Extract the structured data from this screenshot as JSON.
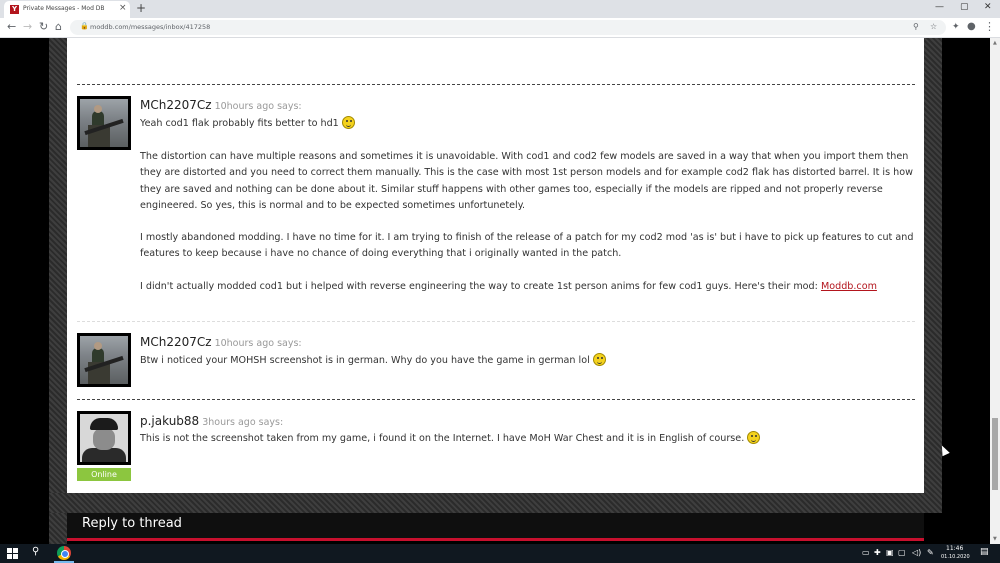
{
  "browser": {
    "tab_title": "Private Messages - Mod DB",
    "tab_favicon": "Y",
    "url": "moddb.com/messages/inbox/417258",
    "controls": {
      "minimize": "—",
      "maximize": "▢",
      "close": "✕",
      "new_tab": "+",
      "tab_close": "×"
    },
    "nav": {
      "back": "←",
      "forward": "→",
      "reload": "↻",
      "home": "⌂"
    },
    "omni_icons": {
      "lock": "🔒",
      "zoom": "search-icon",
      "star": "☆",
      "ext": "puzzle-icon",
      "profile": "profile-icon",
      "menu": "⋮"
    }
  },
  "posts": [
    {
      "author": "MCh2207Cz",
      "time": "10hours ago says:",
      "paragraphs": [
        "Yeah cod1 flak probably fits better to hd1",
        "The distortion can have multiple reasons and sometimes it is unavoidable. With cod1 and cod2 few models are saved in a way that when you import them then they are distorted and you need to correct them manually. This is the case with most 1st person models and for example cod2 flak has distorted barrel. It is how they are saved and nothing can be done about it. Similar stuff happens with other games too, especially if the models are ripped and not properly reverse engineered. So yes, this is normal and to be expected sometimes unfortunetely.",
        "I mostly abandoned modding. I have no time for it. I am trying to finish of the release of a patch for my cod2 mod 'as is' but i have to pick up features to cut and features to keep because i have no chance of doing everything that i originally wanted in the patch.",
        "I didn't actually modded cod1 but i helped with reverse engineering the way to create 1st person anims for few cod1 guys. Here's their mod:"
      ],
      "link": "Moddb.com"
    },
    {
      "author": "MCh2207Cz",
      "time": "10hours ago says:",
      "text": "Btw i noticed your MOHSH screenshot is in german. Why do you have the game in german lol"
    },
    {
      "author": "p.jakub88",
      "time": "3hours ago says:",
      "text": "This is not the screenshot taken from my game, i found it on the Internet. I have MoH War Chest and it is in English of course.",
      "status": "Online"
    }
  ],
  "reply": {
    "title": "Reply to thread"
  },
  "taskbar": {
    "time": "11:46",
    "date": "01.10.2020"
  },
  "colors": {
    "accent": "#b3151d",
    "online": "#8cc63f",
    "reply_accent": "#c8102e"
  }
}
